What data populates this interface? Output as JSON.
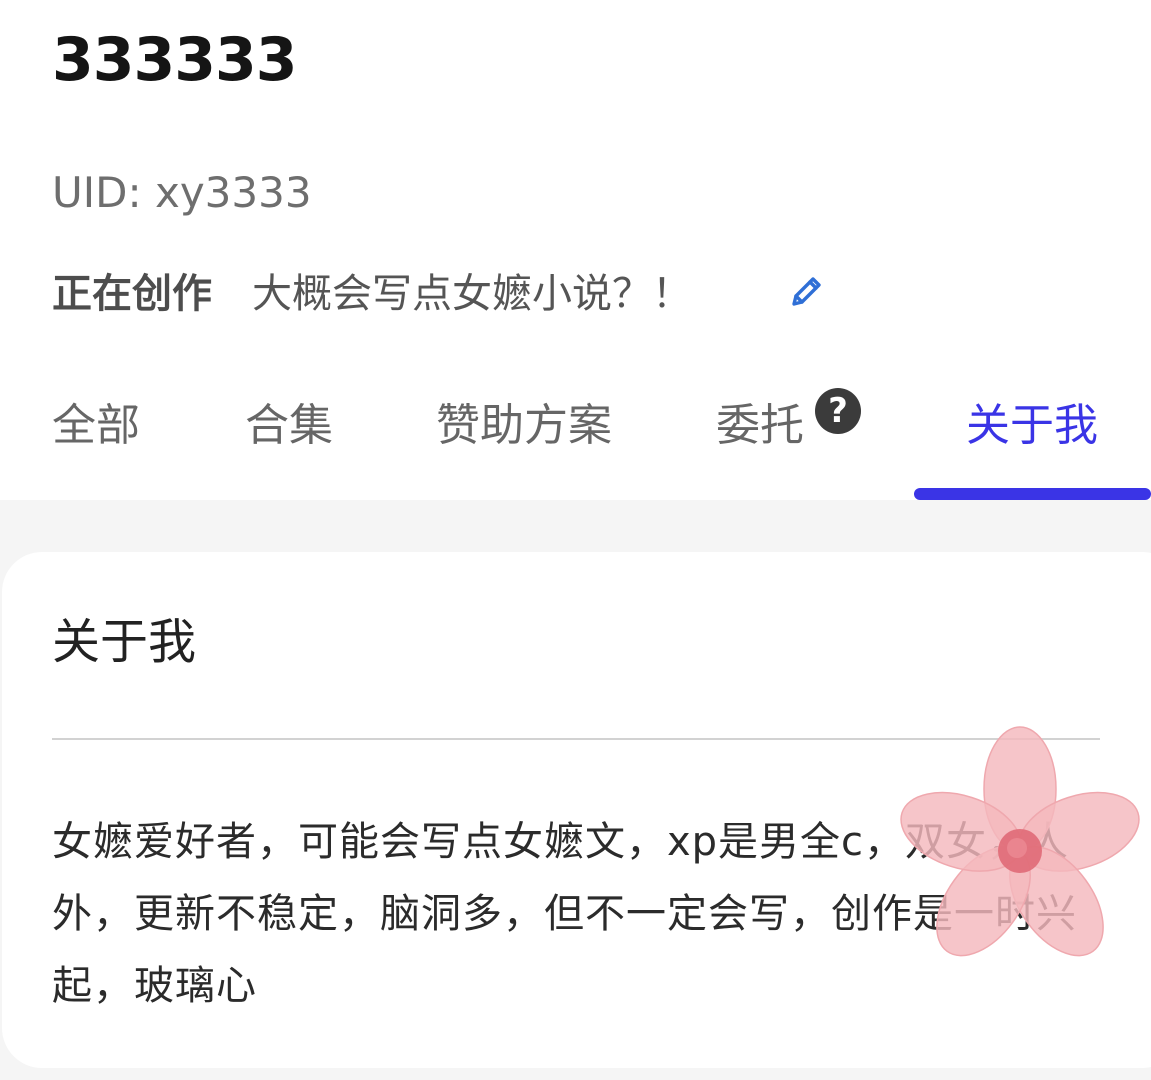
{
  "profile": {
    "username": "333333",
    "uid": "UID: xy3333",
    "creating_label": "正在创作",
    "creating_text": "大概会写点女嬷小说？！"
  },
  "tabs": [
    {
      "label": "全部",
      "active": false
    },
    {
      "label": "合集",
      "active": false
    },
    {
      "label": "赞助方案",
      "active": false
    },
    {
      "label": "委托",
      "active": false
    },
    {
      "label": "关于我",
      "active": true
    }
  ],
  "help_badge": "?",
  "about": {
    "title": "关于我",
    "bio": "女嬷爱好者，可能会写点女嬷文，xp是男全c，双女，人外，更新不稳定，脑洞多，但不一定会写，创作是一时兴起，玻璃心"
  },
  "colors": {
    "accent": "#3a34e6",
    "edit_icon": "#2f6fd6",
    "flower_petal": "#f4b8bd",
    "flower_center": "#e06a77"
  },
  "icons": {
    "edit": "pencil-icon",
    "help": "question-circle-icon",
    "decoration": "flower-sticker"
  }
}
